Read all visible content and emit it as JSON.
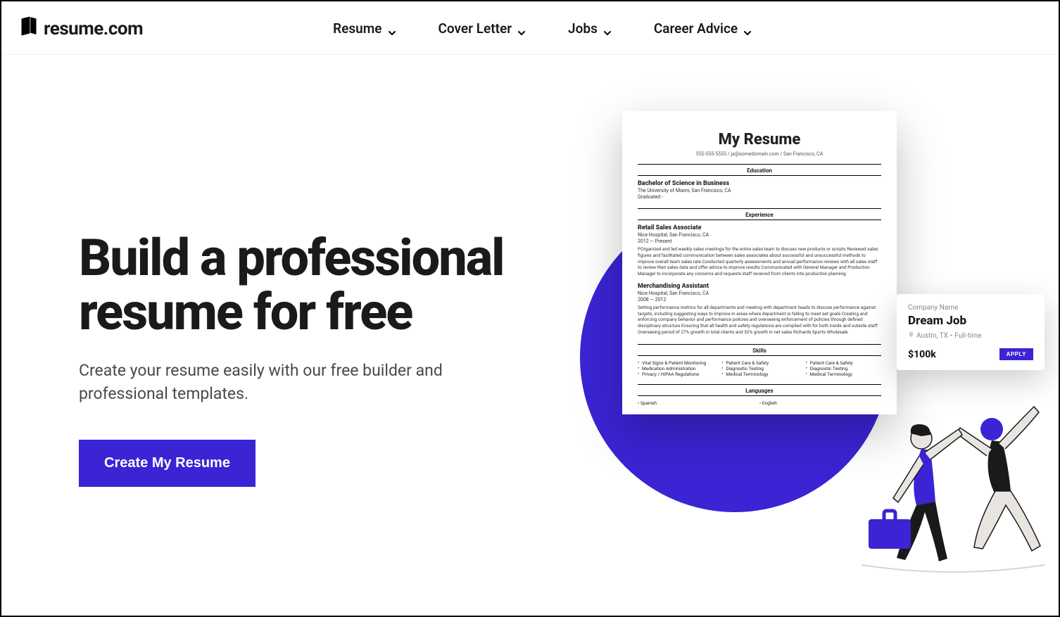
{
  "header": {
    "logo_text": "resume.com",
    "nav": [
      {
        "label": "Resume"
      },
      {
        "label": "Cover Letter"
      },
      {
        "label": "Jobs"
      },
      {
        "label": "Career Advice"
      }
    ]
  },
  "hero": {
    "headline": "Build a professional resume for free",
    "sub": "Create your resume easily with our free builder and professional templates.",
    "cta": "Create My Resume"
  },
  "resume": {
    "title": "My Resume",
    "contact": "555-555-5555 / ja@somedomain.com / San Francisco, CA",
    "sections": {
      "education_label": "Education",
      "experience_label": "Experience",
      "skills_label": "Skills",
      "languages_label": "Languages"
    },
    "education": {
      "degree": "Bachelor of Science in Business",
      "school": "The University of Miami, San Francisco, CA",
      "grad": "Graduated -"
    },
    "experience": [
      {
        "title": "Retail Sales Associate",
        "company": "Nice Hospital, San Francisco, CA",
        "dates": "2012 — Present",
        "body": "POrganized and led weekly sales meetings for the entire sales team to discuss new products or scripts\nReviewed sales figures and facilitated communication between sales associates about successful and unsuccessful methods to improve overall team sales rate\nConducted quarterly assessments and annual performance reviews with all sales staff to review their sales data and offer advice to improve results\nCommunicated with General Manager and Production Manager to incorporate any concerns and requests staff received from clients into production planning"
      },
      {
        "title": "Merchandising Assistant",
        "company": "Nice Hospital, San Francisco, CA",
        "dates": "2008 — 2012",
        "body": "Setting performance metrics for all departments and meeting with department heads to discuss performance against targets, including suggesting ways to improve in areas where department is failing to meet set goals\nCreating and enforcing company behavior and performance policies and overseeing enforcement of policies through defined disciplinary structure\nEnsuring that all health and safety regulations are complied with for both inside and outside staff\nOverseeing period of 27% growth in total clients and 32% growth in net sales\nRichards Sports Wholesale"
      }
    ],
    "skills": [
      [
        "Vital Signs & Patient Monitoring",
        "Medication Administration",
        "Privacy / HIPAA Regulations"
      ],
      [
        "Patient Care & Safety",
        "Diagnostic Testing",
        "Medical Terminology"
      ],
      [
        "Patient Care & Safety",
        "Diagnostic Testing",
        "Medical Terminology"
      ]
    ],
    "languages": [
      "Spanish",
      "English"
    ]
  },
  "job_card": {
    "label": "Company Name",
    "title": "Dream Job",
    "location": "Austin, TX",
    "type": "Full-time",
    "salary": "$100k",
    "apply": "APPLY"
  }
}
